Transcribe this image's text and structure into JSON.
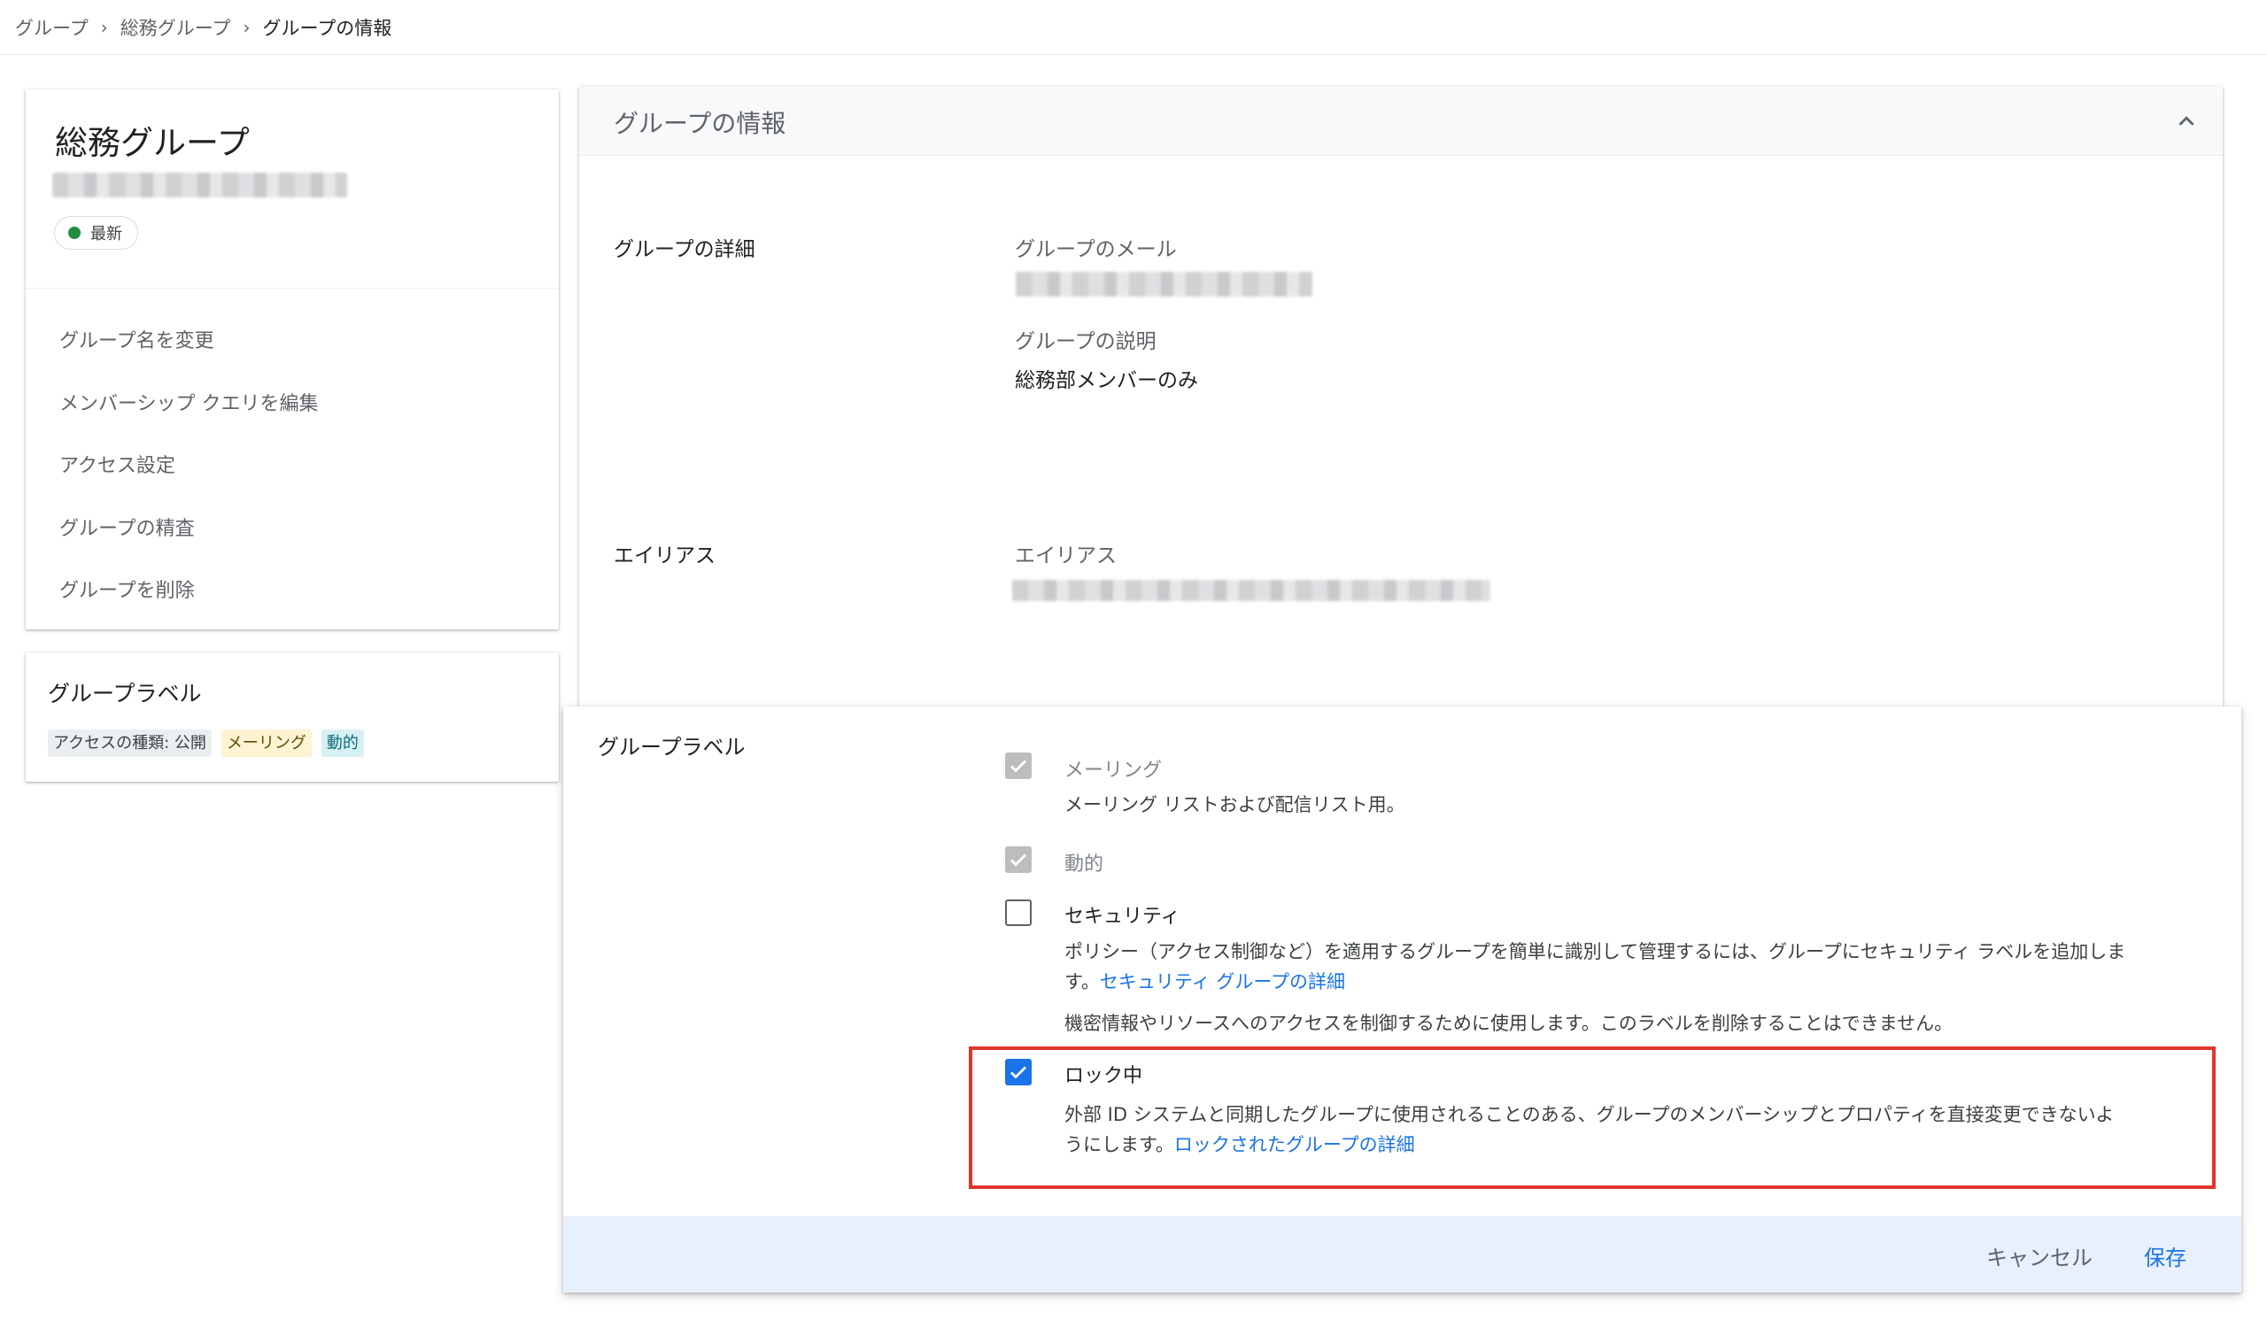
{
  "breadcrumb": {
    "items": [
      "グループ",
      "総務グループ",
      "グループの情報"
    ]
  },
  "left_panel": {
    "group_name": "総務グループ",
    "status": "最新",
    "menu": [
      "グループ名を変更",
      "メンバーシップ クエリを編集",
      "アクセス設定",
      "グループの精査",
      "グループを削除"
    ]
  },
  "labels_panel": {
    "title": "グループラベル",
    "chips": [
      "アクセスの種類: 公開",
      "メーリング",
      "動的"
    ]
  },
  "info_panel": {
    "header": "グループの情報",
    "details_section": "グループの詳細",
    "email_label": "グループのメール",
    "description_label": "グループの説明",
    "description_value": "総務部メンバーのみ",
    "alias_section": "エイリアス",
    "alias_label": "エイリアス"
  },
  "label_dialog": {
    "section": "グループラベル",
    "options": {
      "mailing": {
        "title": "メーリング",
        "desc": "メーリング リストおよび配信リスト用。"
      },
      "dynamic": {
        "title": "動的"
      },
      "security": {
        "title": "セキュリティ",
        "desc": "ポリシー（アクセス制御など）を適用するグループを簡単に識別して管理するには、グループにセキュリティ ラベルを追加しま",
        "desc2": "す。",
        "link": "セキュリティ グループの詳細",
        "note": "機密情報やリソースへのアクセスを制御するために使用します。このラベルを削除することはできません。"
      },
      "locked": {
        "title": "ロック中",
        "desc": "外部 ID システムと同期したグループに使用されることのある、グループのメンバーシップとプロパティを直接変更できないよ",
        "desc2": "うにします。",
        "link": "ロックされたグループの詳細"
      }
    },
    "cancel_label": "キャンセル",
    "save_label": "保存"
  },
  "colors": {
    "accent": "#1a73e8",
    "highlight": "#e0362b",
    "status_green": "#1e8e3e"
  }
}
